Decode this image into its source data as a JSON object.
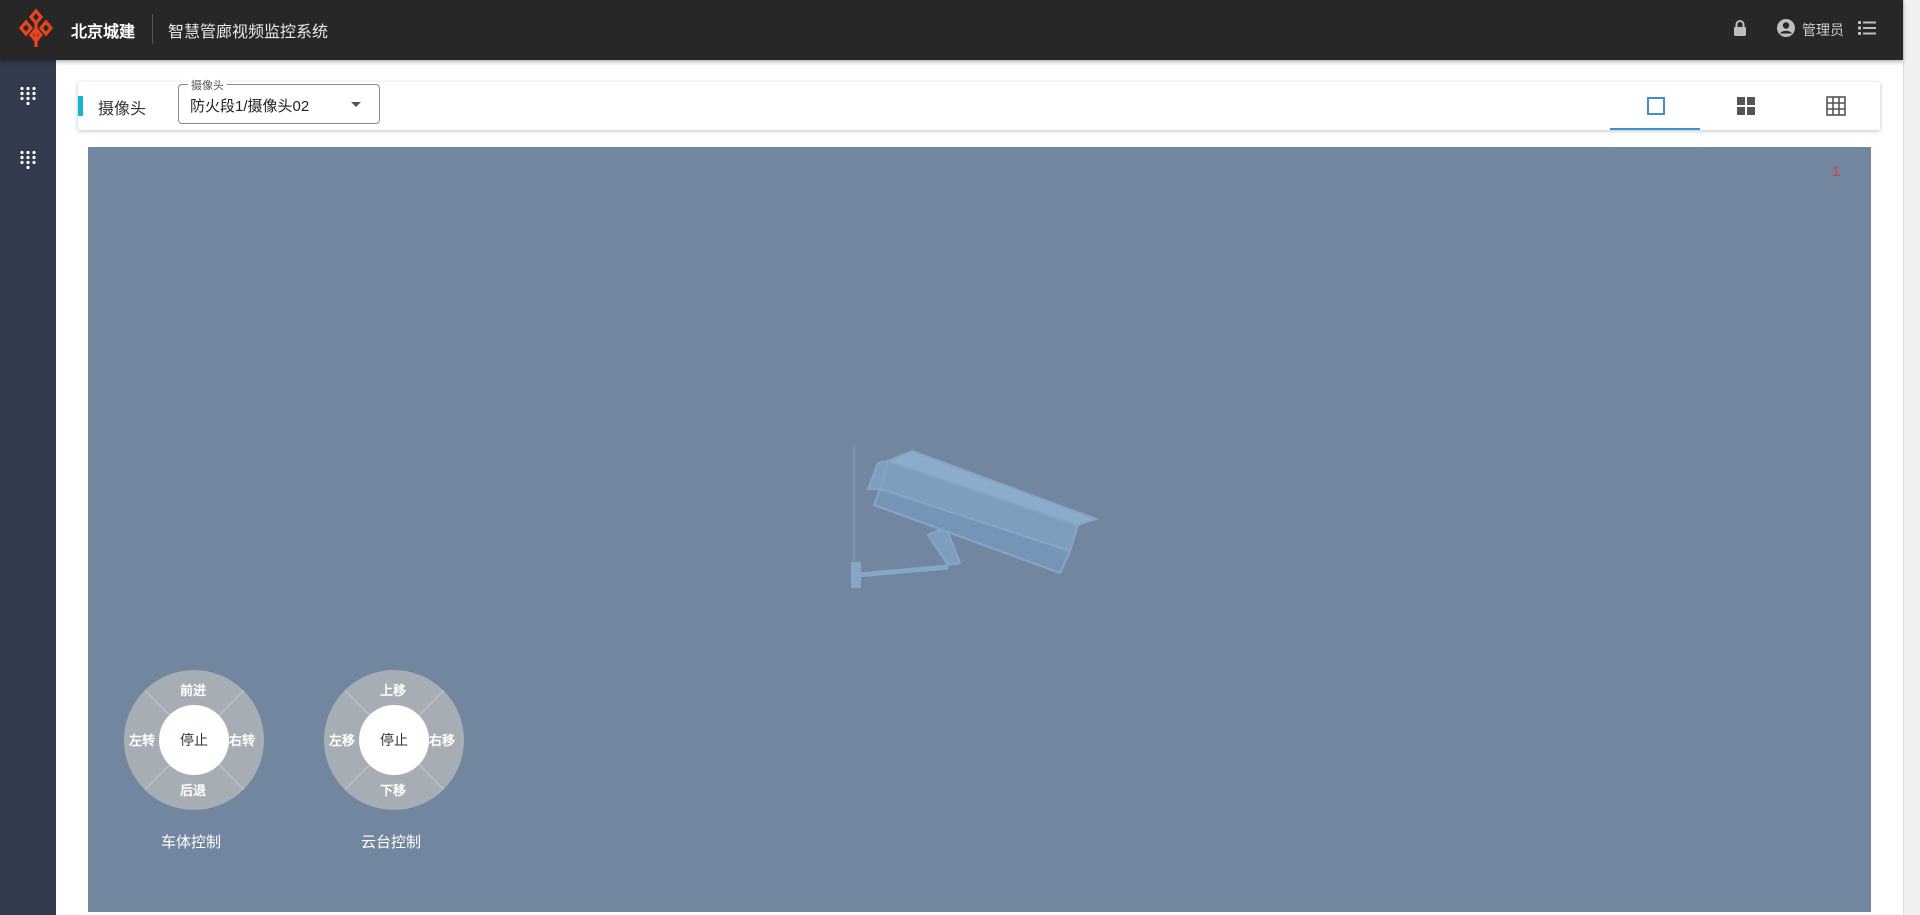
{
  "header": {
    "brand": "北京城建",
    "system_title": "智慧管廊视频监控系统",
    "user": "管理员",
    "brand_color": "#e8451c"
  },
  "sidebar": {
    "items": [
      {
        "icon": "apps-grid-icon"
      },
      {
        "icon": "apps-grid-icon"
      }
    ]
  },
  "toolbar": {
    "label": "摄像头",
    "select": {
      "legend": "摄像头",
      "value": "防火段1/摄像头02"
    },
    "layouts": [
      {
        "name": "single",
        "icon": "single-view-icon",
        "active": true
      },
      {
        "name": "quad",
        "icon": "four-grid-icon",
        "active": false
      },
      {
        "name": "nine",
        "icon": "nine-grid-icon",
        "active": false
      }
    ]
  },
  "video": {
    "channel_number": "1",
    "placeholder_icon": "cctv-camera-icon"
  },
  "controls": {
    "body": {
      "up": "前进",
      "down": "后退",
      "left": "左转",
      "right": "右转",
      "center": "停止",
      "label": "车体控制"
    },
    "ptz": {
      "up": "上移",
      "down": "下移",
      "left": "左移",
      "right": "右移",
      "center": "停止",
      "label": "云台控制"
    }
  }
}
